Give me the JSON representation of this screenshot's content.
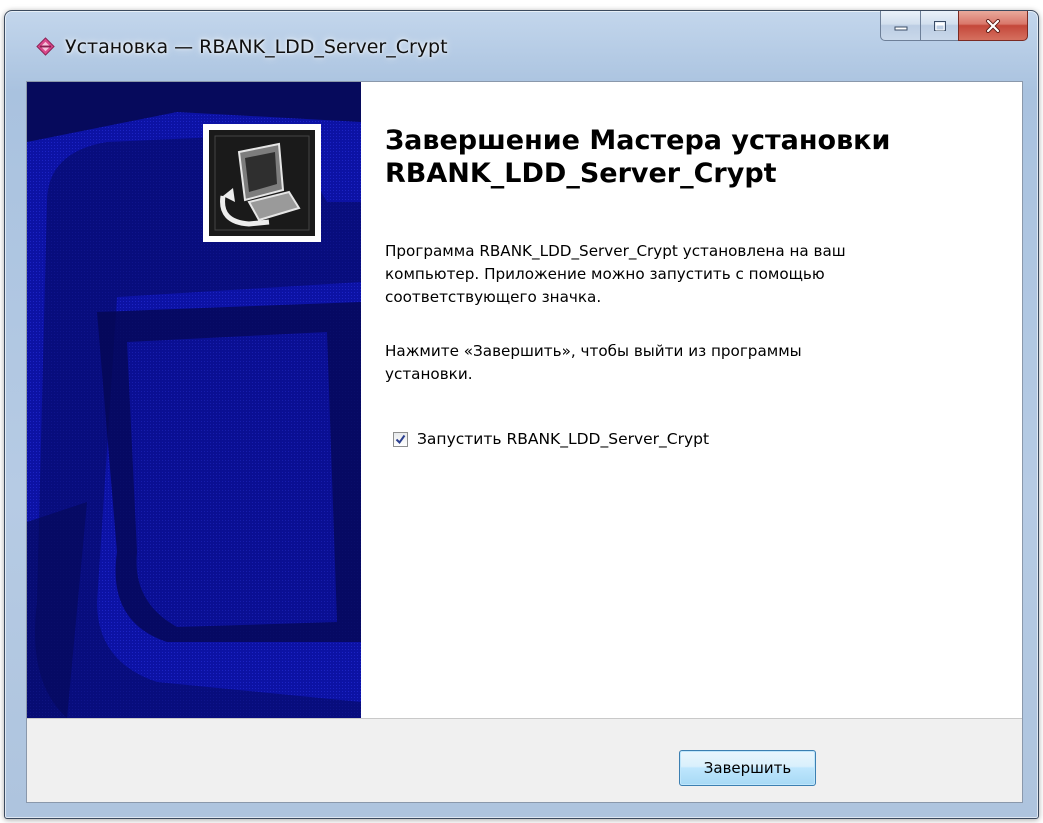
{
  "window": {
    "title": "Установка — RBANK_LDD_Server_Crypt",
    "minimize_icon": "minimize-icon",
    "maximize_icon": "maximize-icon",
    "close_icon": "close-icon"
  },
  "sidebar": {
    "image": "setup-computer-icon"
  },
  "content": {
    "heading_line1": "Завершение Мастера установки",
    "heading_line2": "RBANK_LDD_Server_Crypt",
    "paragraph1_line1": "Программа RBANK_LDD_Server_Crypt установлена на ваш",
    "paragraph1_line2": "компьютер. Приложение можно запустить с помощью",
    "paragraph1_line3": "соответствующего значка.",
    "paragraph2_line1": "Нажмите «Завершить», чтобы выйти из программы",
    "paragraph2_line2": "установки.",
    "checkbox_label": "Запустить RBANK_LDD_Server_Crypt",
    "checkbox_checked": true
  },
  "footer": {
    "finish_label": "Завершить"
  },
  "colors": {
    "sidebar_bg": "#060a5c",
    "sidebar_shape": "#1a1aa8",
    "button_border": "#3c7fb1"
  }
}
